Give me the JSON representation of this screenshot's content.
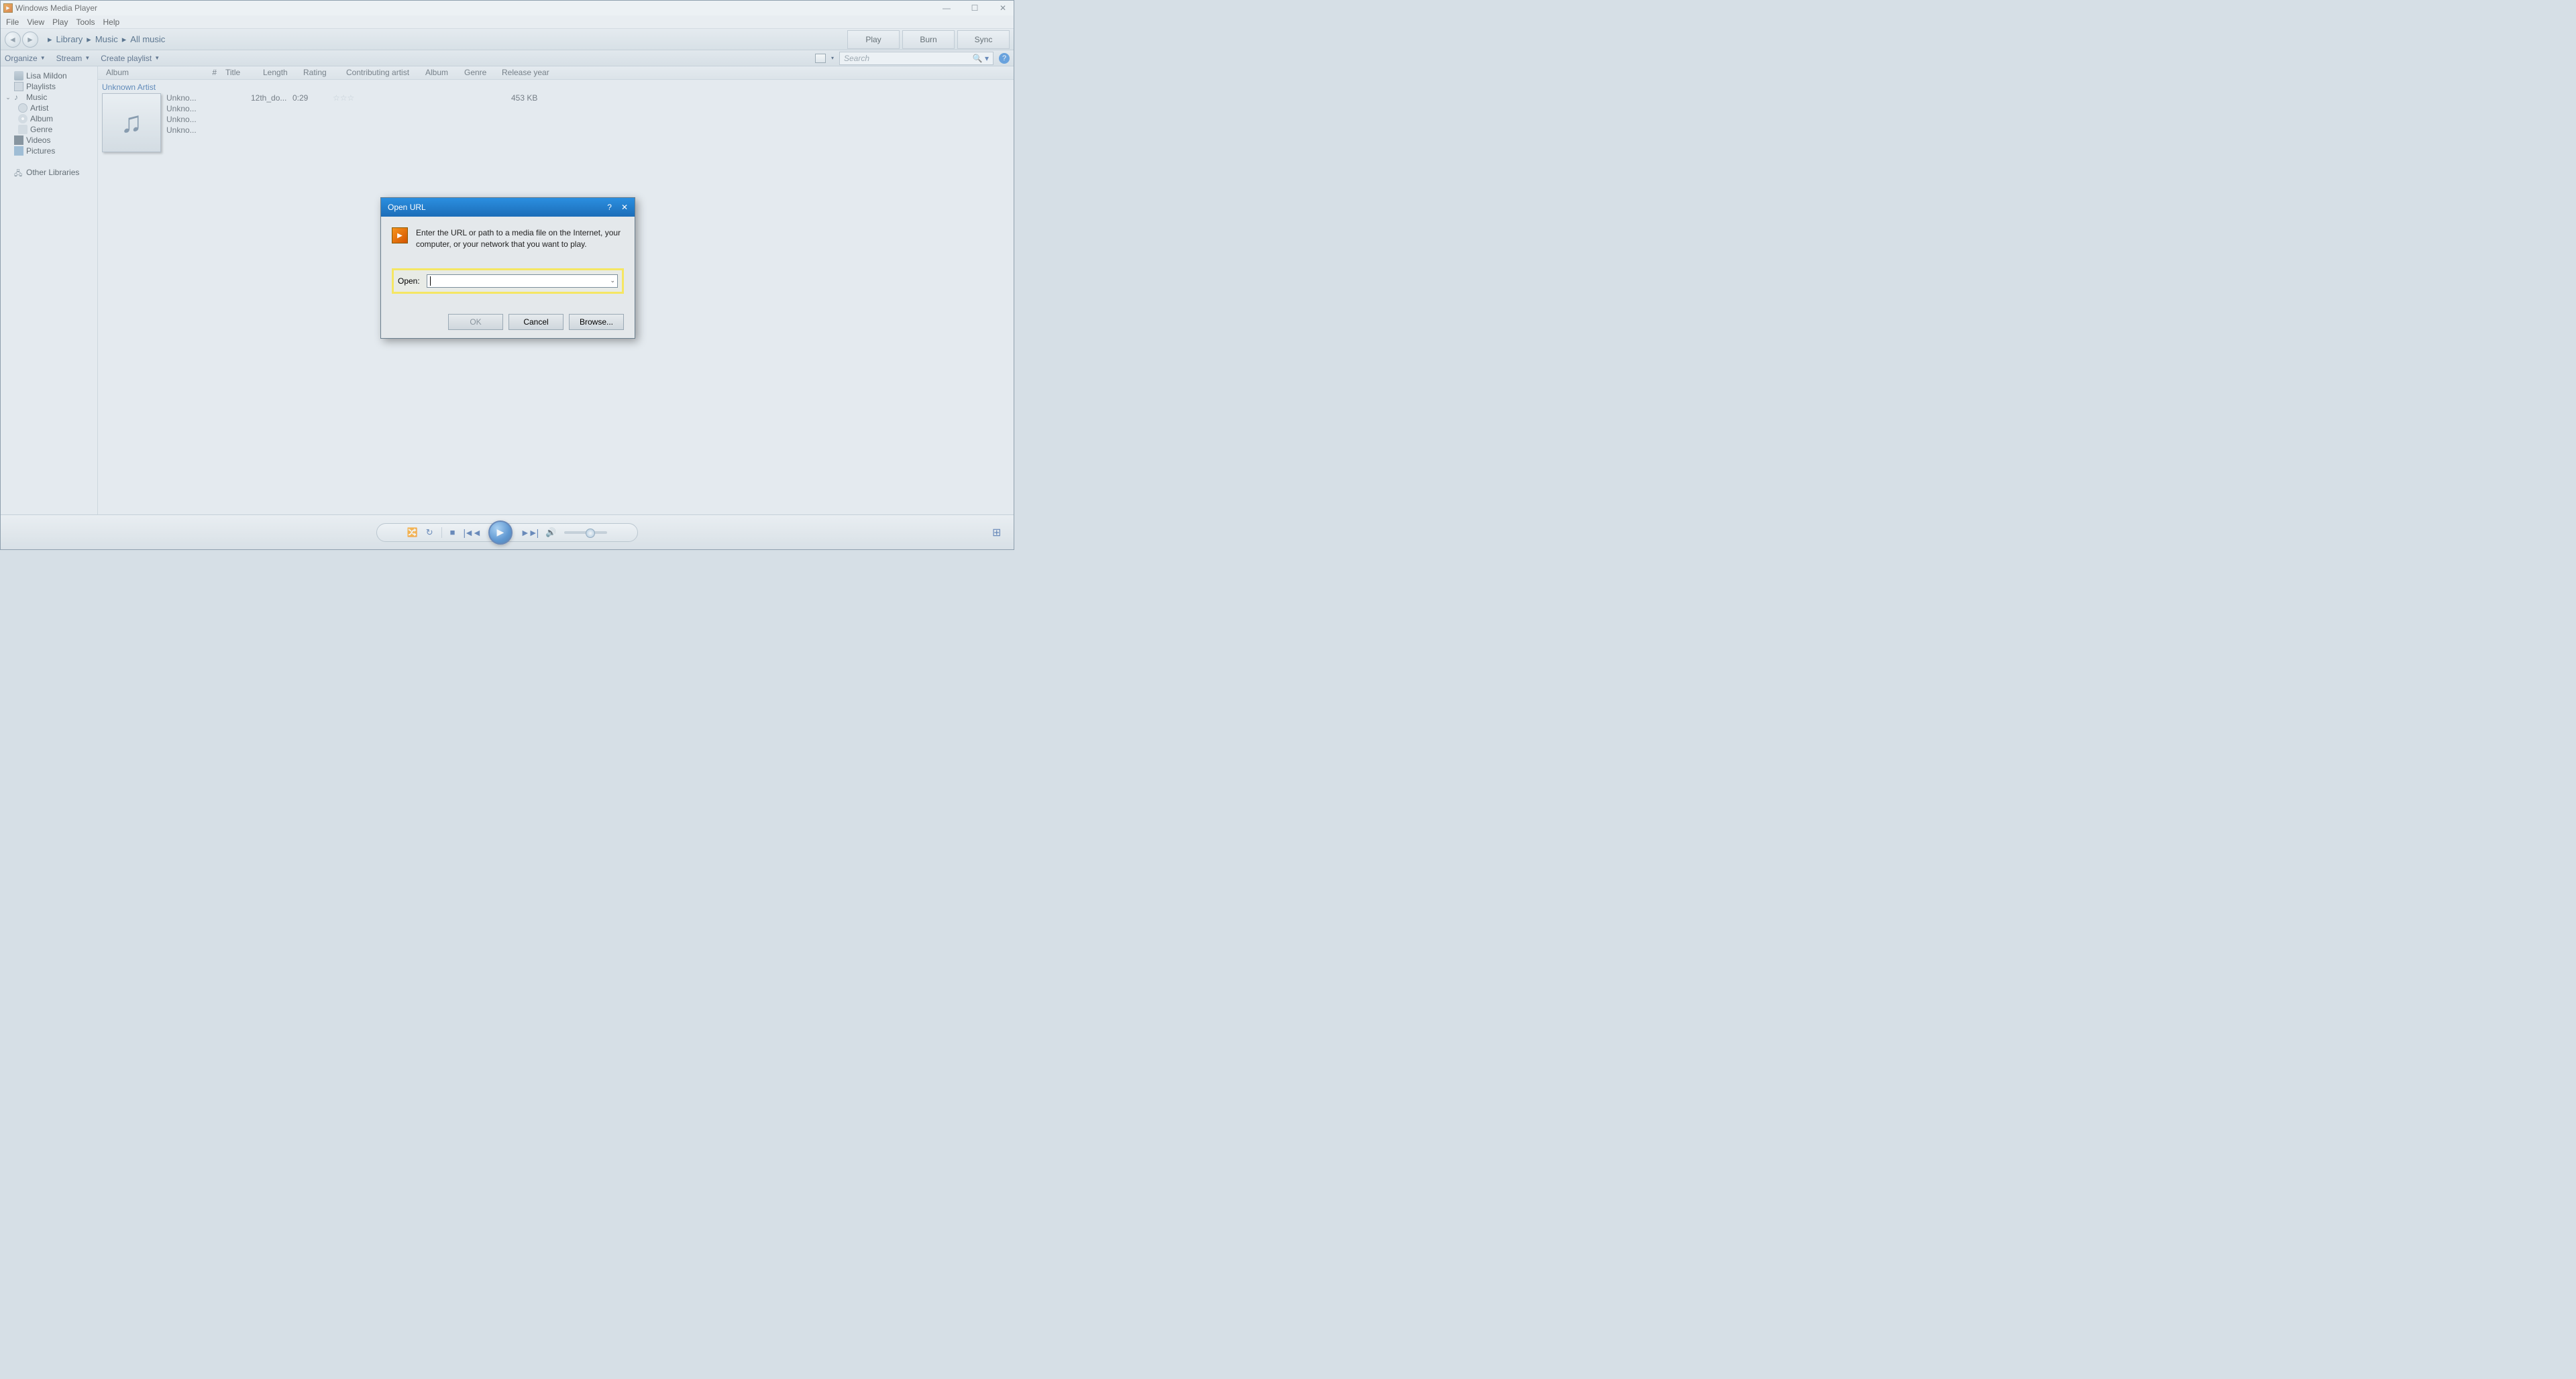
{
  "titlebar": {
    "app_title": "Windows Media Player"
  },
  "menubar": [
    "File",
    "View",
    "Play",
    "Tools",
    "Help"
  ],
  "breadcrumb": [
    "Library",
    "Music",
    "All music"
  ],
  "tabs": [
    "Play",
    "Burn",
    "Sync"
  ],
  "toolbar": {
    "organize": "Organize",
    "stream": "Stream",
    "create": "Create playlist"
  },
  "search": {
    "placeholder": "Search"
  },
  "sidebar": {
    "user": "Lisa Mildon",
    "items": [
      "Playlists",
      "Music",
      "Artist",
      "Album",
      "Genre",
      "Videos",
      "Pictures",
      "Other Libraries"
    ]
  },
  "columns": [
    "Album",
    "#",
    "Title",
    "Length",
    "Rating",
    "Contributing artist",
    "Album",
    "Genre",
    "Release year"
  ],
  "content": {
    "artist": "Unknown Artist",
    "meta": [
      "Unkno...",
      "Unkno...",
      "Unkno...",
      "Unkno..."
    ],
    "track_title": "12th_do...",
    "track_length": "0:29",
    "track_size": "453 KB"
  },
  "dialog": {
    "title": "Open URL",
    "body": "Enter the URL or path to a media file on the Internet, your computer, or your network that you want to play.",
    "open_label": "Open:",
    "ok": "OK",
    "cancel": "Cancel",
    "browse": "Browse..."
  }
}
